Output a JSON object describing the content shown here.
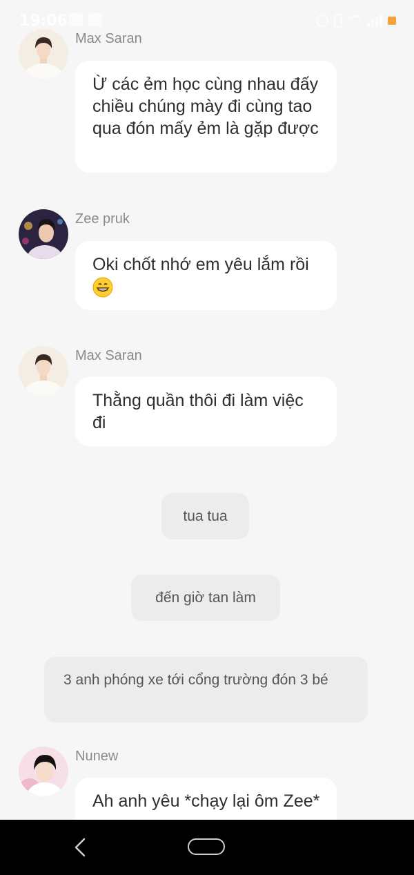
{
  "status_bar": {
    "time": "19:06",
    "icons_left": [
      "notification-icon",
      "image-icon"
    ],
    "icons_right": [
      "alarm-icon",
      "vibrate-icon",
      "wifi-icon",
      "signal-icon",
      "battery-icon"
    ],
    "battery_color": "#f4a340"
  },
  "messages": [
    {
      "sender": "Max Saran",
      "avatar": "avatar-max-saran",
      "text": "Ừ các ẻm học cùng nhau đấy chiều chúng mày đi cùng tao qua đón mấy ẻm là gặp được"
    },
    {
      "sender": "Zee pruk",
      "avatar": "avatar-zee-pruk",
      "text": "Oki chốt nhớ em yêu lắm rồi",
      "emoji": "grinning-face-icon"
    },
    {
      "sender": "Max Saran",
      "avatar": "avatar-max-saran",
      "text": "Thằng quần thôi đi làm việc đi"
    },
    {
      "sender": "Nunew",
      "avatar": "avatar-nunew",
      "text": "Ah anh yêu *chạy lại ôm Zee*"
    }
  ],
  "narrations": [
    {
      "text": "tua tua"
    },
    {
      "text": "đến giờ tan làm"
    },
    {
      "text": "3 anh phóng xe tới cổng trường đón 3 bé"
    }
  ],
  "colors": {
    "background": "#f6f6f6",
    "bubble": "#ffffff",
    "narration_pill": "#ececec",
    "sender_name": "#8a8a8a",
    "nav_bar": "#000000"
  },
  "nav_bar": {
    "icons": [
      "back-icon",
      "home-icon"
    ]
  }
}
